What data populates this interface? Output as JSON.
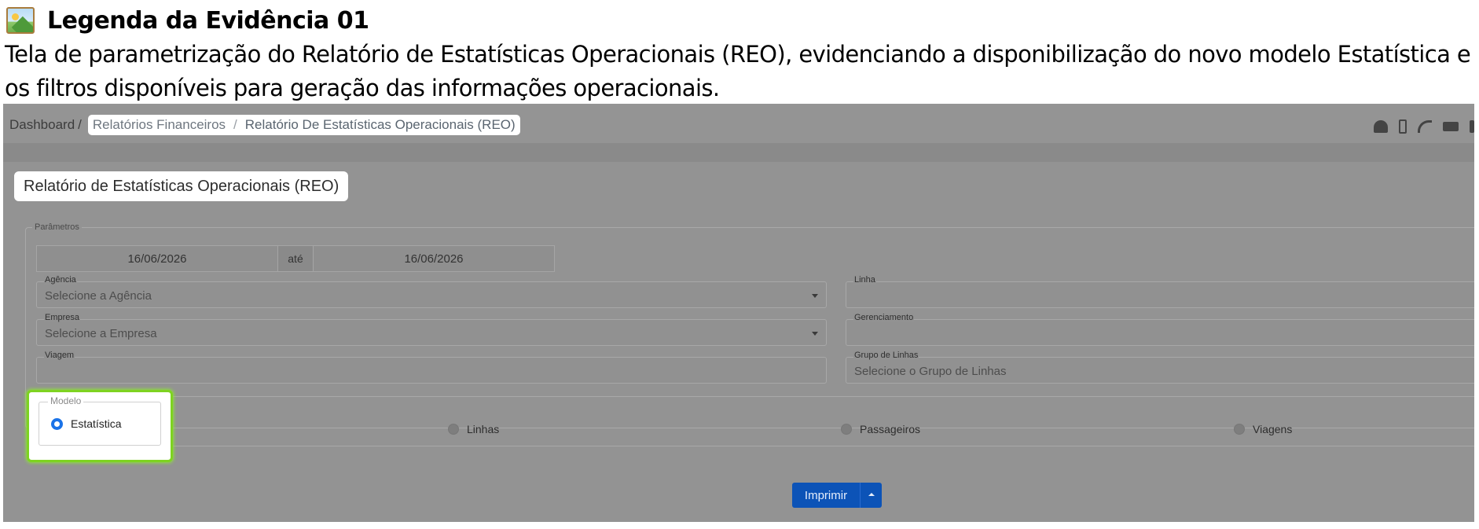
{
  "caption": {
    "icon": "picture-icon",
    "title": "Legenda da Evidência 01",
    "body": "Tela de parametrização do Relatório de Estatísticas Operacionais (REO), evidenciando a disponibilização do novo modelo Estatística e os filtros disponíveis para geração das informações operacionais."
  },
  "breadcrumb": {
    "home": "Dashboard",
    "sep": "/",
    "section": "Relatórios Financeiros",
    "current": "Relatório De Estatísticas Operacionais (REO)"
  },
  "top_icons": [
    "user-settings-icon",
    "phone-icon",
    "signal-icon",
    "card-icon",
    "overflow-icon"
  ],
  "page": {
    "title": "Relatório de Estatísticas Operacionais (REO)"
  },
  "params": {
    "legend": "Parâmetros",
    "date_from": "16/06/2026",
    "date_sep": "até",
    "date_to": "16/06/2026",
    "agencia": {
      "label": "Agência",
      "placeholder": "Selecione a Agência"
    },
    "linha": {
      "label": "Linha",
      "value": ""
    },
    "empresa": {
      "label": "Empresa",
      "placeholder": "Selecione a Empresa"
    },
    "gerenciamento": {
      "label": "Gerenciamento",
      "value": ""
    },
    "viagem": {
      "label": "Viagem",
      "value": ""
    },
    "grupo_linhas": {
      "label": "Grupo de Linhas",
      "placeholder": "Selecione o Grupo de Linhas"
    }
  },
  "modelo": {
    "legend": "Modelo",
    "options": [
      "Estatística",
      "Linhas",
      "Passageiros",
      "Viagens"
    ],
    "selected": "Estatística"
  },
  "actions": {
    "print_label": "Imprimir"
  },
  "colors": {
    "highlight_border": "#7ed321",
    "primary_button": "#0c53b7",
    "radio_selected": "#1a73e8"
  }
}
